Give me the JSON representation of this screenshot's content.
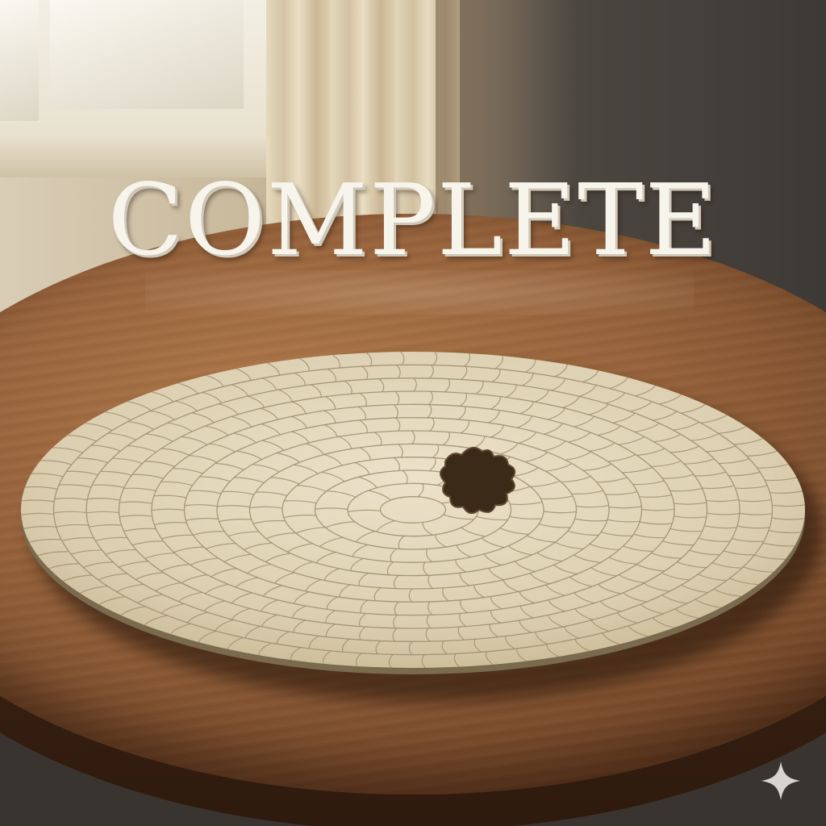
{
  "headline": "COMPLETE",
  "puzzle": {
    "shape": "circular jigsaw puzzle",
    "missing_pieces": 1,
    "rings": 12,
    "color": "#e4d8bd"
  },
  "colors": {
    "table_wood": "#93603a",
    "puzzle_face": "#e4d8bd",
    "letters": "#f7f4ec"
  },
  "icons": {
    "sparkle": "sparkle-icon"
  }
}
